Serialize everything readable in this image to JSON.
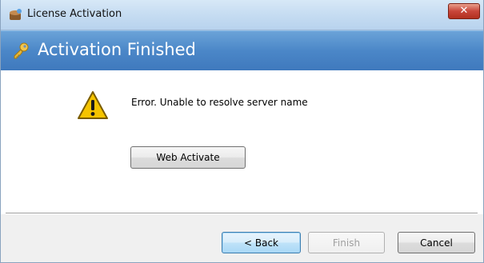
{
  "window": {
    "title": "License Activation",
    "close_label": "✕"
  },
  "header": {
    "title": "Activation Finished"
  },
  "content": {
    "message": "Error. Unable to resolve server name",
    "web_activate_label": "Web Activate"
  },
  "footer": {
    "back_label": "< Back",
    "finish_label": "Finish",
    "cancel_label": "Cancel"
  },
  "icons": {
    "app": "app-icon",
    "key": "key-icon",
    "warning": "warning-icon"
  },
  "colors": {
    "header_blue": "#4b87c8",
    "close_red": "#c8463a",
    "warning_yellow": "#f5c400"
  }
}
